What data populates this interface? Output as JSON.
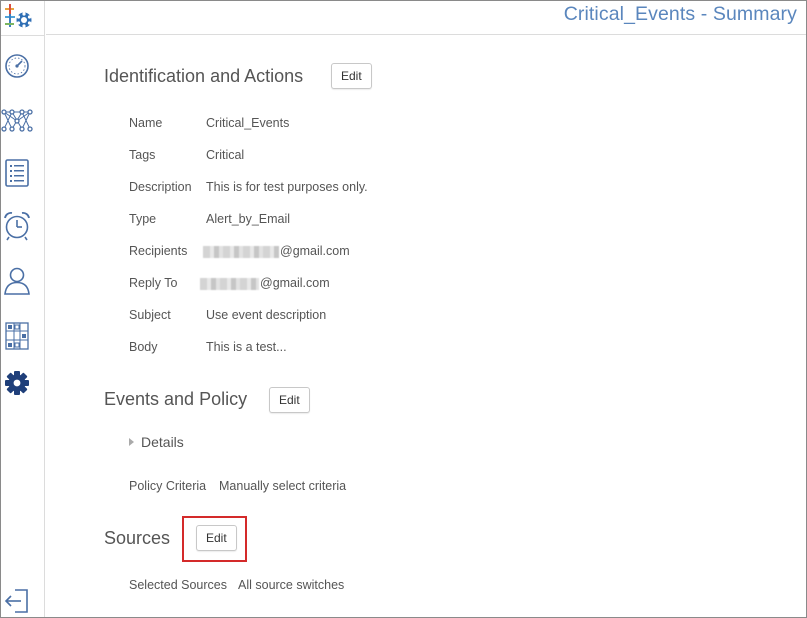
{
  "header": {
    "title": "Critical_Events - Summary"
  },
  "sidebar": {
    "items": [
      {
        "icon": "dashboard-gauge-icon",
        "active": false
      },
      {
        "icon": "network-topology-icon",
        "active": false
      },
      {
        "icon": "list-icon",
        "active": false
      },
      {
        "icon": "alarm-clock-icon",
        "active": false
      },
      {
        "icon": "user-icon",
        "active": false
      },
      {
        "icon": "switch-panel-icon",
        "active": false
      },
      {
        "icon": "gear-icon",
        "active": true
      }
    ],
    "logout_icon": "logout-icon"
  },
  "identification": {
    "title": "Identification and Actions",
    "edit_label": "Edit",
    "rows": [
      {
        "label": "Name",
        "value": "Critical_Events"
      },
      {
        "label": "Tags",
        "value": "Critical"
      },
      {
        "label": "Description",
        "value": "This is for test purposes only."
      },
      {
        "label": "Type",
        "value": "Alert_by_Email"
      },
      {
        "label": "Recipients",
        "value": "@gmail.com"
      },
      {
        "label": "Reply To",
        "value": "@gmail.com"
      },
      {
        "label": "Subject",
        "value": "Use event description"
      },
      {
        "label": "Body",
        "value": "This is a test..."
      }
    ]
  },
  "events_policy": {
    "title": "Events and Policy",
    "edit_label": "Edit",
    "details_label": "Details",
    "policy_label": "Policy Criteria",
    "policy_value": "Manually select criteria"
  },
  "sources": {
    "title": "Sources",
    "edit_label": "Edit",
    "selected_label": "Selected Sources",
    "selected_value": "All source switches"
  },
  "colors": {
    "title_blue": "#5a86bd",
    "icon_blue": "#4a6fa5",
    "gear_active": "#1f3f7a",
    "highlight_red": "#d42a2a"
  }
}
